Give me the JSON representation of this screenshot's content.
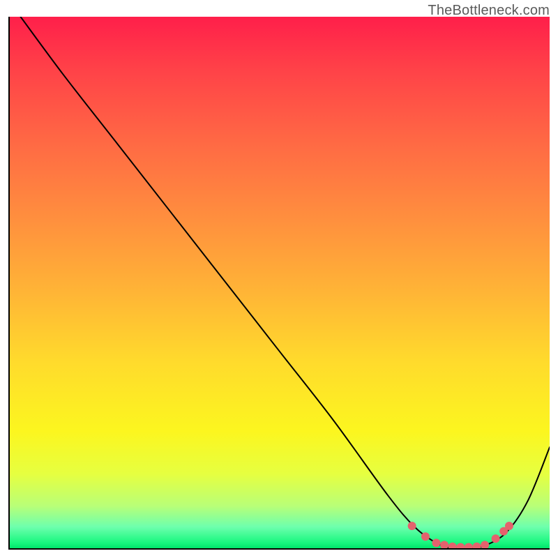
{
  "watermark": "TheBottleneck.com",
  "chart_data": {
    "type": "line",
    "title": "",
    "xlabel": "",
    "ylabel": "",
    "xlim": [
      0,
      100
    ],
    "ylim": [
      0,
      100
    ],
    "grid": false,
    "legend": false,
    "series": [
      {
        "name": "bottleneck-curve",
        "color": "#000000",
        "x": [
          2,
          10,
          20,
          30,
          40,
          50,
          60,
          70,
          75,
          79,
          82,
          85,
          88,
          92,
          96,
          100
        ],
        "y": [
          100,
          89,
          76,
          63,
          50,
          37,
          24,
          10,
          4,
          1,
          0,
          0,
          0.5,
          3,
          9,
          19
        ]
      }
    ],
    "markers": {
      "name": "optimal-range-dots",
      "color": "#e4626d",
      "radius": 6,
      "x": [
        74.5,
        77,
        79,
        80.5,
        82,
        83.5,
        85,
        86.5,
        88,
        90,
        91.5,
        92.5
      ],
      "y": [
        4.2,
        2.2,
        1.0,
        0.6,
        0.3,
        0.2,
        0.2,
        0.3,
        0.6,
        1.8,
        3.2,
        4.2
      ]
    }
  }
}
